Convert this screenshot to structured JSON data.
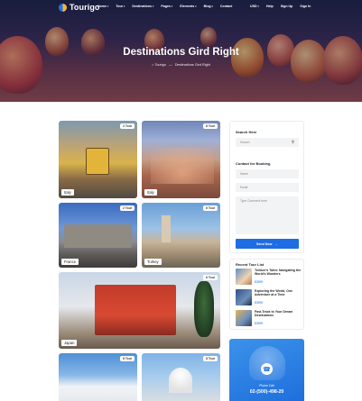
{
  "brand": {
    "name": "Tourigo"
  },
  "nav": {
    "menu": [
      "Home",
      "Tour",
      "Destinations",
      "Pages",
      "Elements",
      "Blog",
      "Contact"
    ],
    "right": [
      "USD",
      "Help",
      "Sign Up",
      "Sign In"
    ]
  },
  "hero": {
    "title": "Destinations Gird Right",
    "breadcrumb": [
      "Tourigo",
      "Destinations Gird Right"
    ]
  },
  "cards": [
    {
      "country": "Italy",
      "tours": "2 Tour"
    },
    {
      "country": "Italy",
      "tours": "8 Tour"
    },
    {
      "country": "France",
      "tours": "2 Tour"
    },
    {
      "country": "Turkey",
      "tours": "6 Tour"
    },
    {
      "country": "Japan",
      "tours": "6 Tour"
    },
    {
      "country": "",
      "tours": "8 Tour"
    },
    {
      "country": "",
      "tours": "8 Tour"
    }
  ],
  "sidebar": {
    "search": {
      "heading": "Search Here",
      "placeholder": "Search"
    },
    "contact": {
      "heading": "Contact for Booking",
      "name_placeholder": "Name",
      "email_placeholder": "Email",
      "comment_placeholder": "Type Comment here",
      "send_label": "Send Now"
    },
    "recent": {
      "heading": "Recent Tour List",
      "items": [
        {
          "title": "Trekker's Tales: Navigating the World's Wonders",
          "price": "$3999"
        },
        {
          "title": "Exploring the World, One Adventure at a Time",
          "price": "$3999"
        },
        {
          "title": "Fast-Track to Your Dream Destinations",
          "price": "$3999"
        }
      ]
    },
    "promo": {
      "call_label": "Phone Call",
      "phone": "02-(500)-498-20"
    }
  },
  "colors": {
    "accent": "#1e6de3"
  }
}
